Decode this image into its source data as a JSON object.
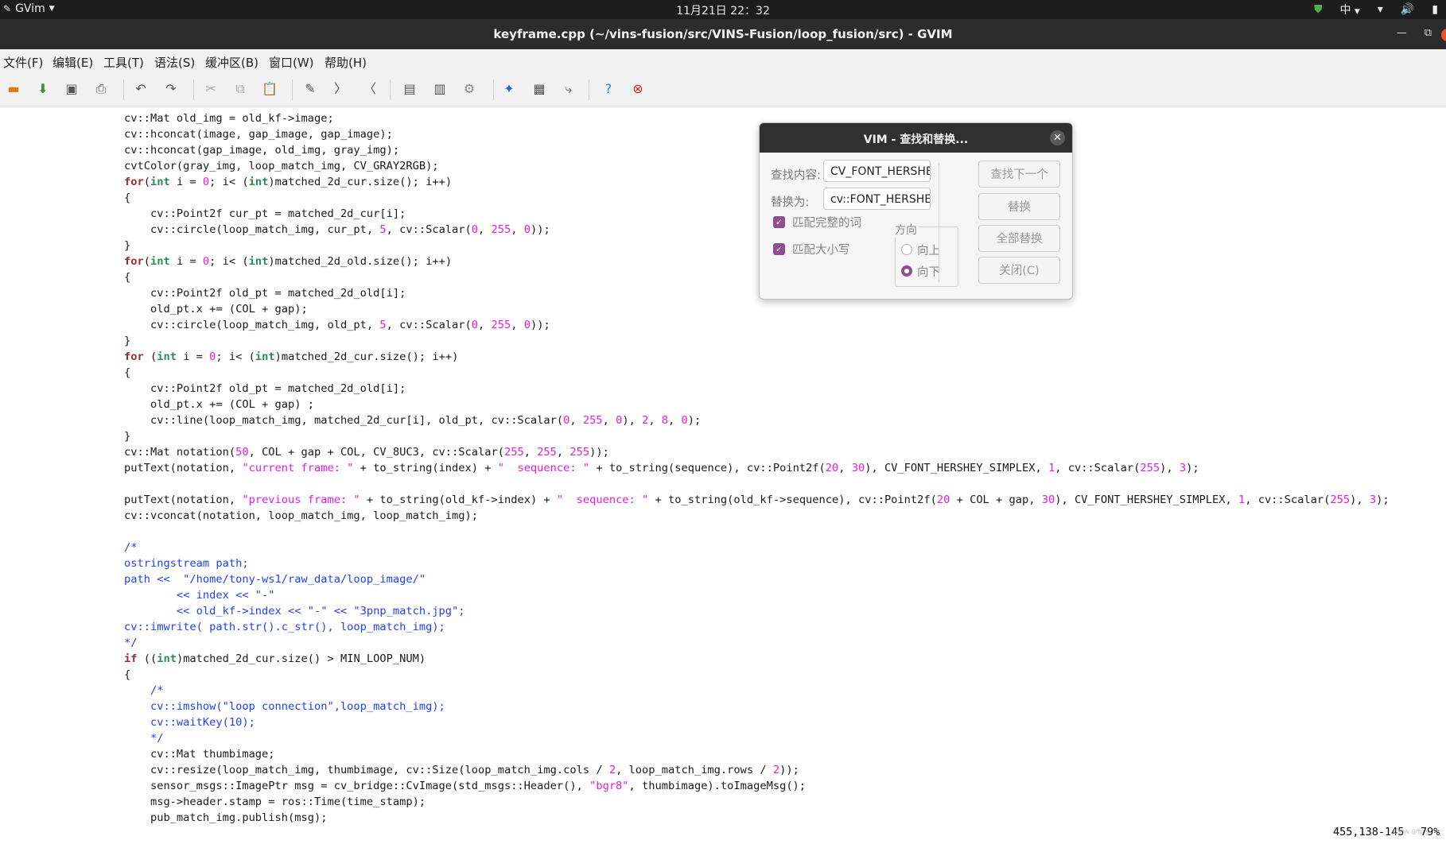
{
  "system_bar": {
    "app_name": "GVim",
    "clock": "11月21日  22：32",
    "input_method": "中"
  },
  "window": {
    "title": "keyframe.cpp (~/vins-fusion/src/VINS-Fusion/loop_fusion/src) - GVIM"
  },
  "menu": {
    "items": [
      "文件(F)",
      "编辑(E)",
      "工具(T)",
      "语法(S)",
      "缓冲区(B)",
      "窗口(W)",
      "帮助(H)"
    ]
  },
  "toolbar": {
    "icons": [
      "open-icon",
      "save-session-icon",
      "save-icon",
      "print-icon",
      "undo-icon",
      "redo-icon",
      "cut-icon",
      "copy-icon",
      "paste-icon",
      "find-replace-icon",
      "find-next-icon",
      "find-prev-icon",
      "load-session-icon",
      "save-session-icon",
      "run-script-icon",
      "make-icon",
      "shell-icon",
      "tags-icon",
      "jump-tag-icon",
      "help-icon",
      "find-help-icon"
    ]
  },
  "editor": {
    "lines": [
      "cv::Mat old_img = old_kf->image;",
      "cv::hconcat(image, gap_image, gap_image);",
      "cv::hconcat(gap_image, old_img, gray_img);",
      "cvtColor(gray_img, loop_match_img, CV_GRAY2RGB);",
      "for(int i = 0; i< (int)matched_2d_cur.size(); i++)",
      "{",
      "    cv::Point2f cur_pt = matched_2d_cur[i];",
      "    cv::circle(loop_match_img, cur_pt, 5, cv::Scalar(0, 255, 0));",
      "}",
      "for(int i = 0; i< (int)matched_2d_old.size(); i++)",
      "{",
      "    cv::Point2f old_pt = matched_2d_old[i];",
      "    old_pt.x += (COL + gap);",
      "    cv::circle(loop_match_img, old_pt, 5, cv::Scalar(0, 255, 0));",
      "}",
      "for (int i = 0; i< (int)matched_2d_cur.size(); i++)",
      "{",
      "    cv::Point2f old_pt = matched_2d_old[i];",
      "    old_pt.x += (COL + gap) ;",
      "    cv::line(loop_match_img, matched_2d_cur[i], old_pt, cv::Scalar(0, 255, 0), 2, 8, 0);",
      "}",
      "cv::Mat notation(50, COL + gap + COL, CV_8UC3, cv::Scalar(255, 255, 255));",
      "putText(notation, \"current frame: \" + to_string(index) + \"  sequence: \" + to_string(sequence), cv::Point2f(20, 30), CV_FONT_HERSHEY_SIMPLEX, 1, cv::Scalar(255), 3);",
      "",
      "putText(notation, \"previous frame: \" + to_string(old_kf->index) + \"  sequence: \" + to_string(old_kf->sequence), cv::Point2f(20 + COL + gap, 30), CV_FONT_HERSHEY_SIMPLEX, 1, cv::Scalar(255), 3);",
      "cv::vconcat(notation, loop_match_img, loop_match_img);",
      "",
      "/*",
      "ostringstream path;",
      "path <<  \"/home/tony-ws1/raw_data/loop_image/\"",
      "        << index << \"-\"",
      "        << old_kf->index << \"-\" << \"3pnp_match.jpg\";",
      "cv::imwrite( path.str().c_str(), loop_match_img);",
      "*/",
      "if ((int)matched_2d_cur.size() > MIN_LOOP_NUM)",
      "{",
      "    /*",
      "    cv::imshow(\"loop connection\",loop_match_img);",
      "    cv::waitKey(10);",
      "    */",
      "    cv::Mat thumbimage;",
      "    cv::resize(loop_match_img, thumbimage, cv::Size(loop_match_img.cols / 2, loop_match_img.rows / 2));",
      "    sensor_msgs::ImagePtr msg = cv_bridge::CvImage(std_msgs::Header(), \"bgr8\", thumbimage).toImageMsg();",
      "    msg->header.stamp = ros::Time(time_stamp);",
      "    pub_match_img.publish(msg);"
    ],
    "cursor": {
      "line": 23,
      "col": 66
    }
  },
  "status": {
    "position": "455,138-145",
    "percent": "79%",
    "watermark": "CSDN @Tony"
  },
  "dialog": {
    "title": "VIM - 查找和替换...",
    "find_label": "查找内容:",
    "find_value": "CV_FONT_HERSHEY_SIMPLEX",
    "replace_label": "替换为:",
    "replace_value": "cv::FONT_HERSHEY_SIMPLEX",
    "match_word_label": "匹配完整的词",
    "match_word_checked": true,
    "match_case_label": "匹配大小写",
    "match_case_checked": true,
    "direction_label": "方向",
    "direction_up": "向上",
    "direction_down": "向下",
    "direction_selected": "向下",
    "btn_find_next": "查找下一个",
    "btn_replace": "替换",
    "btn_replace_all": "全部替换",
    "btn_close": "关闭(C)"
  }
}
